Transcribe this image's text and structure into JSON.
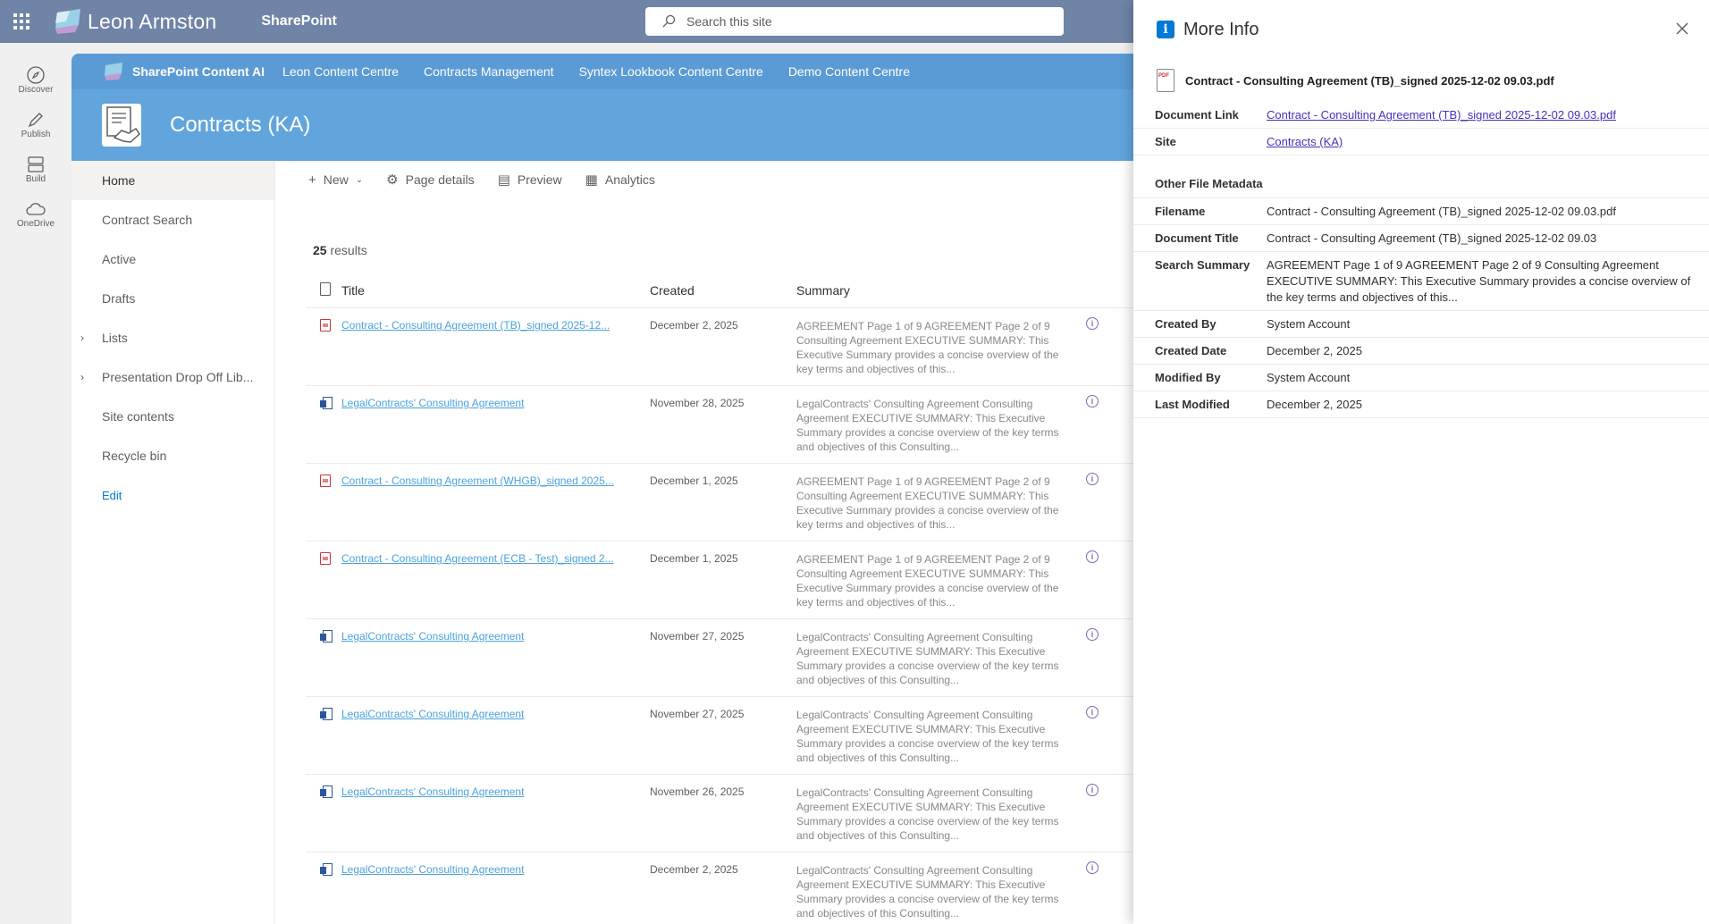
{
  "suitebar": {
    "org_name": "Leon Armston",
    "app_name": "SharePoint",
    "search_placeholder": "Search this site"
  },
  "appbar": {
    "items": [
      {
        "label": "Discover",
        "icon": "compass-icon"
      },
      {
        "label": "Publish",
        "icon": "pencil-icon"
      },
      {
        "label": "Build",
        "icon": "layout-icon"
      },
      {
        "label": "OneDrive",
        "icon": "cloud-icon"
      }
    ]
  },
  "hubnav": {
    "brand": "SharePoint Content AI",
    "links": [
      "Leon Content Centre",
      "Contracts Management",
      "Syntex Lookbook Content Centre",
      "Demo Content Centre"
    ]
  },
  "site": {
    "title": "Contracts (KA)"
  },
  "leftnav": {
    "items": [
      {
        "label": "Home",
        "active": true,
        "expandable": false
      },
      {
        "label": "Contract Search",
        "active": false,
        "expandable": false
      },
      {
        "label": "Active",
        "active": false,
        "expandable": false
      },
      {
        "label": "Drafts",
        "active": false,
        "expandable": false
      },
      {
        "label": "Lists",
        "active": false,
        "expandable": true
      },
      {
        "label": "Presentation Drop Off Lib...",
        "active": false,
        "expandable": true
      },
      {
        "label": "Site contents",
        "active": false,
        "expandable": false
      },
      {
        "label": "Recycle bin",
        "active": false,
        "expandable": false
      }
    ],
    "edit_label": "Edit"
  },
  "cmdbar": {
    "new_label": "New",
    "page_details_label": "Page details",
    "preview_label": "Preview",
    "analytics_label": "Analytics"
  },
  "results": {
    "count": "25",
    "count_suffix": "results",
    "columns": {
      "title": "Title",
      "created": "Created",
      "summary": "Summary"
    },
    "rows": [
      {
        "type": "pdf",
        "title": "Contract - Consulting Agreement (TB)_signed 2025-12...",
        "created": "December 2, 2025",
        "summary": "AGREEMENT Page 1 of 9 AGREEMENT Page 2 of 9 Consulting Agreement EXECUTIVE SUMMARY: This Executive Summary provides a concise overview of the key terms and objectives of this..."
      },
      {
        "type": "docx",
        "title": "LegalContracts' Consulting Agreement",
        "created": "November 28, 2025",
        "summary": "LegalContracts' Consulting Agreement Consulting Agreement EXECUTIVE SUMMARY: This Executive Summary provides a concise overview of the key terms and objectives of this Consulting..."
      },
      {
        "type": "pdf",
        "title": "Contract - Consulting Agreement (WHGB)_signed 2025...",
        "created": "December 1, 2025",
        "summary": "AGREEMENT Page 1 of 9 AGREEMENT Page 2 of 9 Consulting Agreement EXECUTIVE SUMMARY: This Executive Summary provides a concise overview of the key terms and objectives of this..."
      },
      {
        "type": "pdf",
        "title": "Contract - Consulting Agreement (ECB - Test)_signed 2...",
        "created": "December 1, 2025",
        "summary": "AGREEMENT Page 1 of 9 AGREEMENT Page 2 of 9 Consulting Agreement EXECUTIVE SUMMARY: This Executive Summary provides a concise overview of the key terms and objectives of this..."
      },
      {
        "type": "docx",
        "title": "LegalContracts' Consulting Agreement",
        "created": "November 27, 2025",
        "summary": "LegalContracts' Consulting Agreement Consulting Agreement EXECUTIVE SUMMARY: This Executive Summary provides a concise overview of the key terms and objectives of this Consulting..."
      },
      {
        "type": "docx",
        "title": "LegalContracts' Consulting Agreement",
        "created": "November 27, 2025",
        "summary": "LegalContracts' Consulting Agreement Consulting Agreement EXECUTIVE SUMMARY: This Executive Summary provides a concise overview of the key terms and objectives of this Consulting..."
      },
      {
        "type": "docx",
        "title": "LegalContracts' Consulting Agreement",
        "created": "November 26, 2025",
        "summary": "LegalContracts' Consulting Agreement Consulting Agreement EXECUTIVE SUMMARY: This Executive Summary provides a concise overview of the key terms and objectives of this Consulting..."
      },
      {
        "type": "docx",
        "title": "LegalContracts' Consulting Agreement",
        "created": "December 2, 2025",
        "summary": "LegalContracts' Consulting Agreement Consulting Agreement EXECUTIVE SUMMARY: This Executive Summary provides a concise overview of the key terms and objectives of this Consulting..."
      }
    ]
  },
  "panel": {
    "title": "More Info",
    "file_name": "Contract - Consulting Agreement (TB)_signed 2025-12-02 09.03.pdf",
    "links": [
      {
        "key": "Document Link",
        "value": "Contract - Consulting Agreement (TB)_signed 2025-12-02 09.03.pdf"
      },
      {
        "key": "Site",
        "value": "Contracts (KA)"
      }
    ],
    "metadata_title": "Other File Metadata",
    "metadata": [
      {
        "key": "Filename",
        "value": "Contract - Consulting Agreement (TB)_signed 2025-12-02 09.03.pdf"
      },
      {
        "key": "Document Title",
        "value": "Contract - Consulting Agreement (TB)_signed 2025-12-02 09.03"
      },
      {
        "key": "Search Summary",
        "value": "AGREEMENT Page 1 of 9 AGREEMENT Page 2 of 9 Consulting Agreement EXECUTIVE SUMMARY: This Executive Summary provides a concise overview of the key terms and objectives of this..."
      },
      {
        "key": "Created By",
        "value": "System Account"
      },
      {
        "key": "Created Date",
        "value": "December 2, 2025"
      },
      {
        "key": "Modified By",
        "value": "System Account"
      },
      {
        "key": "Last Modified",
        "value": "December 2, 2025"
      }
    ]
  },
  "colors": {
    "suitebar": "#6f84a6",
    "hubnav": "#5b9bd5",
    "site_header": "#62a5dd",
    "link": "#4aa3df",
    "panel_link": "#4b2fbf",
    "info_accent": "#0078d4"
  }
}
